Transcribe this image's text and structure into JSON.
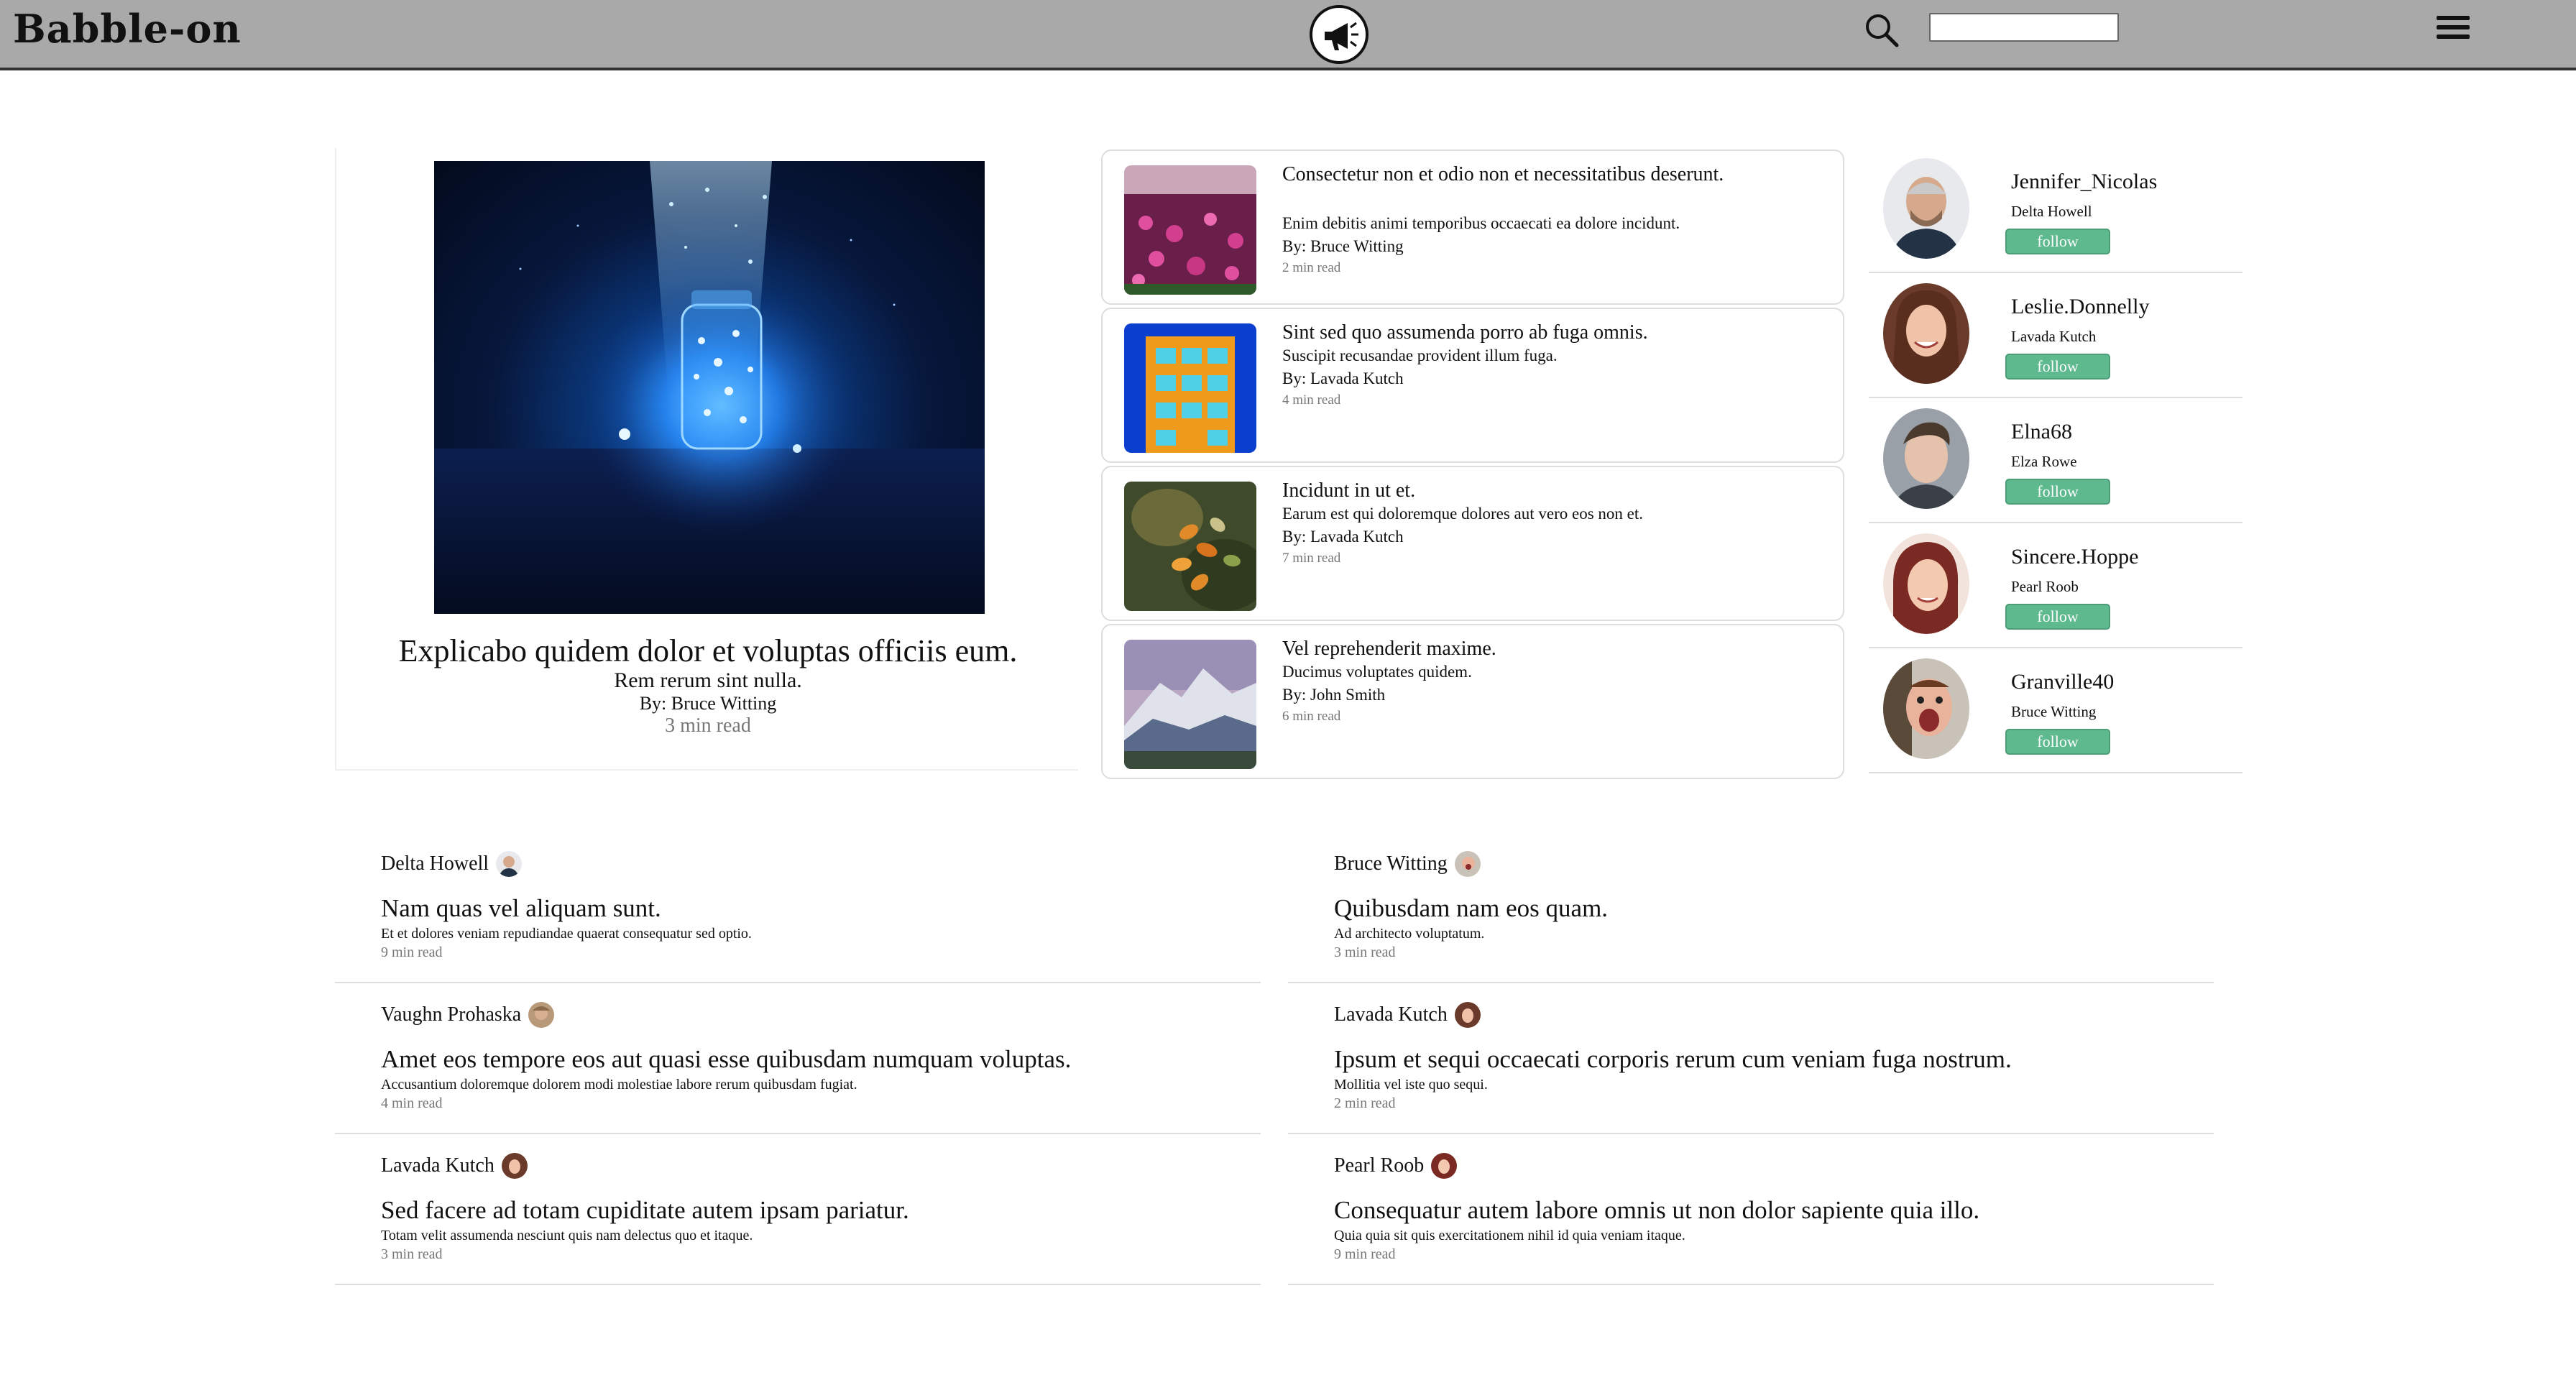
{
  "header": {
    "brand": "Babble-on",
    "logo_icon": "megaphone-icon",
    "search_icon": "search-icon",
    "search_placeholder": "",
    "menu_icon": "hamburger-menu-icon"
  },
  "featured": {
    "title": "Explicabo quidem dolor et voluptas officiis eum.",
    "subtitle": "Rem rerum sint nulla.",
    "author": "By: Bruce Witting",
    "read_time": "3 min read"
  },
  "articles": [
    {
      "title": "Consectetur non et odio non et necessitatibus deserunt.",
      "subtitle": "Enim debitis animi temporibus occaecati ea dolore incidunt.",
      "author": "By: Bruce Witting",
      "read_time": "2 min read"
    },
    {
      "title": "Sint sed quo assumenda porro ab fuga omnis.",
      "subtitle": "Suscipit recusandae provident illum fuga.",
      "author": "By: Lavada Kutch",
      "read_time": "4 min read"
    },
    {
      "title": "Incidunt in ut et.",
      "subtitle": "Earum est qui doloremque dolores aut vero eos non et.",
      "author": "By: Lavada Kutch",
      "read_time": "7 min read"
    },
    {
      "title": "Vel reprehenderit maxime.",
      "subtitle": "Ducimus voluptates quidem.",
      "author": "By: John Smith",
      "read_time": "6 min read"
    }
  ],
  "follow": {
    "button_label": "follow",
    "users": [
      {
        "username": "Jennifer_Nicolas",
        "name": "Delta Howell"
      },
      {
        "username": "Leslie.Donnelly",
        "name": "Lavada Kutch"
      },
      {
        "username": "Elna68",
        "name": "Elza Rowe"
      },
      {
        "username": "Sincere.Hoppe",
        "name": "Pearl Roob"
      },
      {
        "username": "Granville40",
        "name": "Bruce Witting"
      }
    ]
  },
  "feed": [
    {
      "author": "Delta Howell",
      "title": "Nam quas vel aliquam sunt.",
      "subtitle": "Et et dolores veniam repudiandae quaerat consequatur sed optio.",
      "read_time": "9 min read"
    },
    {
      "author": "Bruce Witting",
      "title": "Quibusdam nam eos quam.",
      "subtitle": "Ad architecto voluptatum.",
      "read_time": "3 min read"
    },
    {
      "author": "Vaughn Prohaska",
      "title": "Amet eos tempore eos aut quasi esse quibusdam numquam voluptas.",
      "subtitle": "Accusantium doloremque dolorem modi molestiae labore rerum quibusdam fugiat.",
      "read_time": "4 min read"
    },
    {
      "author": "Lavada Kutch",
      "title": "Ipsum et sequi occaecati corporis rerum cum veniam fuga nostrum.",
      "subtitle": "Mollitia vel iste quo sequi.",
      "read_time": "2 min read"
    },
    {
      "author": "Lavada Kutch",
      "title": "Sed facere ad totam cupiditate autem ipsam pariatur.",
      "subtitle": "Totam velit assumenda nesciunt quis nam delectus quo et itaque.",
      "read_time": "3 min read"
    },
    {
      "author": "Pearl Roob",
      "title": "Consequatur autem labore omnis ut non dolor sapiente quia illo.",
      "subtitle": "Quia quia sit quis exercitationem nihil id quia veniam itaque.",
      "read_time": "9 min read"
    }
  ],
  "colors": {
    "header_bg": "#a9a9a9",
    "follow_button": "#5fb98f",
    "muted_text": "#777777"
  }
}
